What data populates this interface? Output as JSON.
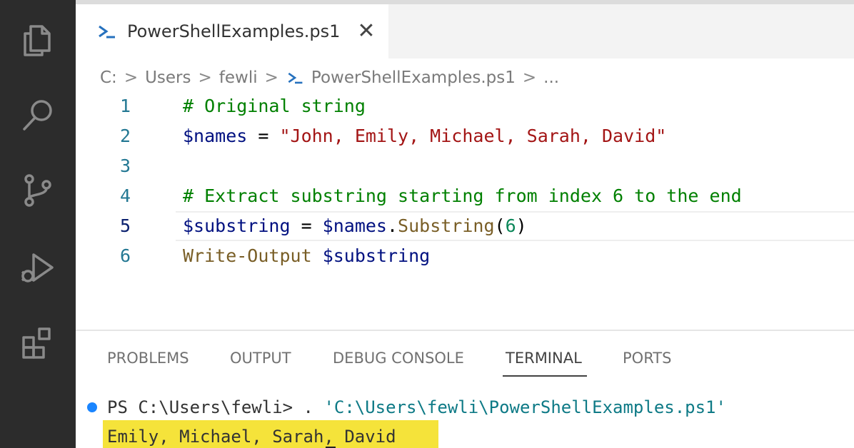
{
  "tab": {
    "label": "PowerShellExamples.ps1",
    "close": "✕"
  },
  "breadcrumb": {
    "items": [
      "C:",
      "Users",
      "fewli",
      "PowerShellExamples.ps1",
      "..."
    ],
    "separator": ">"
  },
  "editor": {
    "lines": [
      {
        "number": "1",
        "tokens": [
          {
            "t": "# Original string",
            "k": "comment"
          }
        ]
      },
      {
        "number": "2",
        "tokens": [
          {
            "t": "$names",
            "k": "var"
          },
          {
            "t": " = ",
            "k": "op"
          },
          {
            "t": "\"John, Emily, Michael, Sarah, David\"",
            "k": "str"
          }
        ]
      },
      {
        "number": "3",
        "tokens": []
      },
      {
        "number": "4",
        "tokens": [
          {
            "t": "# Extract substring starting from index 6 to the end",
            "k": "comment"
          }
        ]
      },
      {
        "number": "5",
        "tokens": [
          {
            "t": "$substring",
            "k": "var"
          },
          {
            "t": " = ",
            "k": "op"
          },
          {
            "t": "$names",
            "k": "var"
          },
          {
            "t": ".",
            "k": "op"
          },
          {
            "t": "Substring",
            "k": "fn"
          },
          {
            "t": "(",
            "k": "op"
          },
          {
            "t": "6",
            "k": "num"
          },
          {
            "t": ")",
            "k": "op"
          }
        ]
      },
      {
        "number": "6",
        "tokens": [
          {
            "t": "Write-Output",
            "k": "fn"
          },
          {
            "t": " ",
            "k": "op"
          },
          {
            "t": "$substring",
            "k": "var"
          }
        ]
      }
    ],
    "active_line": 5
  },
  "panel": {
    "tabs": [
      "PROBLEMS",
      "OUTPUT",
      "DEBUG CONSOLE",
      "TERMINAL",
      "PORTS"
    ],
    "active_tab": "TERMINAL"
  },
  "terminal": {
    "prompt": "PS C:\\Users\\fewli> . ",
    "command_arg": "'C:\\Users\\fewli\\PowerShellExamples.ps1'",
    "output": "Emily, Michael, Sarah, David"
  },
  "colors": {
    "activity_bar": "#2c2c2c",
    "highlight": "#f5e33a",
    "status_dot": "#1a85ff"
  }
}
